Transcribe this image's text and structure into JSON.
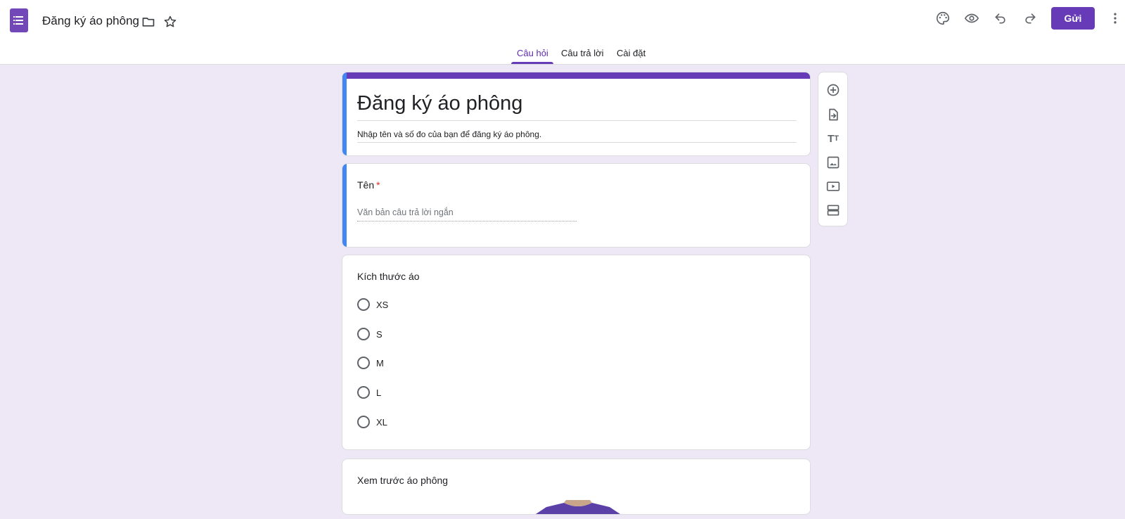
{
  "app": {
    "doc_title": "Đăng ký áo phông",
    "send_label": "Gửi"
  },
  "tabs": [
    {
      "label": "Câu hỏi",
      "active": true
    },
    {
      "label": "Câu trả lời",
      "active": false
    },
    {
      "label": "Cài đặt",
      "active": false
    }
  ],
  "form": {
    "title": "Đăng ký áo phông",
    "description": "Nhập tên và số đo của bạn để đăng ký áo phông."
  },
  "questions": [
    {
      "label": "Tên",
      "required_mark": "*",
      "placeholder": "Văn bản câu trả lời ngắn"
    },
    {
      "label": "Kích thước áo",
      "options": [
        "XS",
        "S",
        "M",
        "L",
        "XL"
      ]
    },
    {
      "label": "Xem trước áo phông"
    }
  ],
  "toolbar_icons": [
    "add-question-icon",
    "import-questions-icon",
    "title-text-icon",
    "image-icon",
    "video-icon",
    "section-icon"
  ],
  "header_icons": [
    "palette-icon",
    "preview-eye-icon",
    "undo-icon",
    "redo-icon",
    "more-vert-icon"
  ],
  "colors": {
    "accent": "#673ab7",
    "background": "#ede7f6",
    "focus_accent": "#4285f4",
    "required": "#d93025"
  },
  "tshirt_color": "#5b40a8"
}
